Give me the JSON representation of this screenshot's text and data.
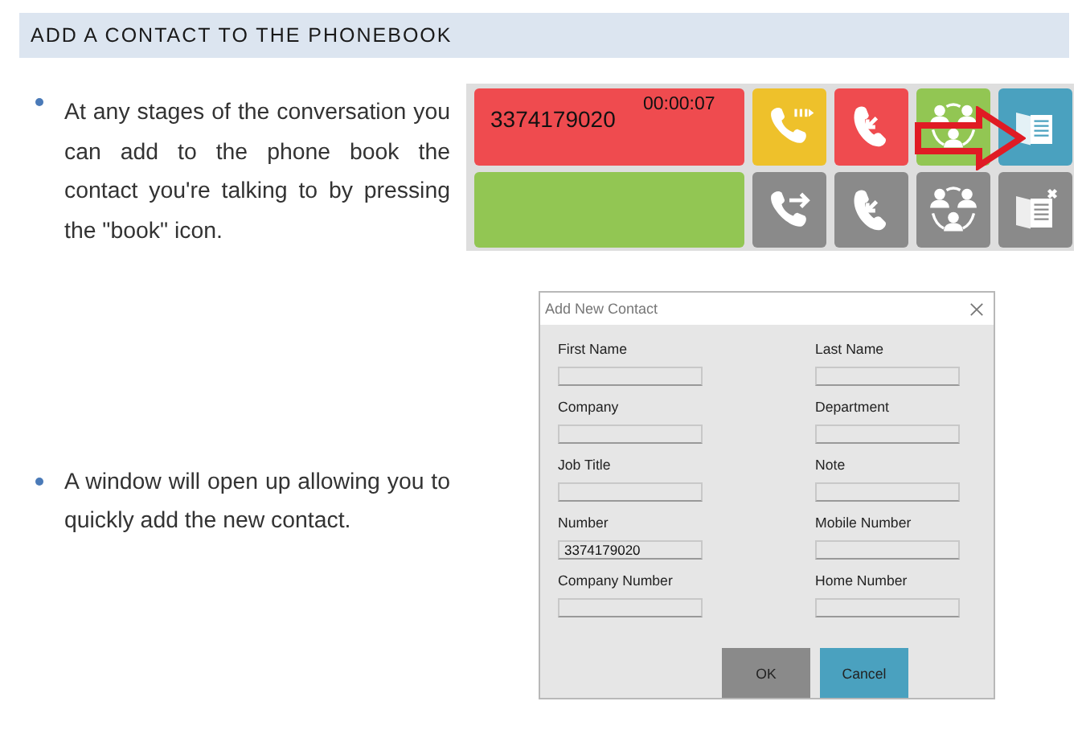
{
  "heading": "ADD A CONTACT TO THE PHONEBOOK",
  "steps": [
    {
      "text": "At any stages of the conversation you can add to the phone book the contact you're talking to by pressing the \"book\" icon.",
      "kind": "call_panel"
    },
    {
      "text": "A window will open up allowing you to quickly add the new contact.",
      "kind": "dialog"
    }
  ],
  "call_panel": {
    "number": "3374179020",
    "timer": "00:00:07",
    "tiles": [
      {
        "kind": "hold",
        "color": "#eec12b"
      },
      {
        "kind": "hangup",
        "color": "#ef4b4f"
      },
      {
        "kind": "conference",
        "color": "#92c653"
      },
      {
        "kind": "book",
        "color": "#4aa1bf"
      },
      {
        "kind": "transfer",
        "color": "#8a8a8a"
      },
      {
        "kind": "hangup",
        "color": "#8a8a8a"
      },
      {
        "kind": "conference",
        "color": "#8a8a8a"
      },
      {
        "kind": "book_remove",
        "color": "#8a8a8a"
      }
    ]
  },
  "dialog": {
    "title": "Add New Contact",
    "fields": [
      {
        "label": "First Name"
      },
      {
        "label": "Last Name"
      },
      {
        "label": "Company"
      },
      {
        "label": "Department"
      },
      {
        "label": "Job Title"
      },
      {
        "label": "Note"
      },
      {
        "label": "Number",
        "value": "3374179020"
      },
      {
        "label": "Mobile Number"
      },
      {
        "label": "Company Number"
      },
      {
        "label": "Home Number"
      }
    ],
    "buttons": [
      {
        "label": "OK",
        "color": "#8a8a8a"
      },
      {
        "label": "Cancel",
        "color": "#4aa1bf"
      }
    ]
  }
}
